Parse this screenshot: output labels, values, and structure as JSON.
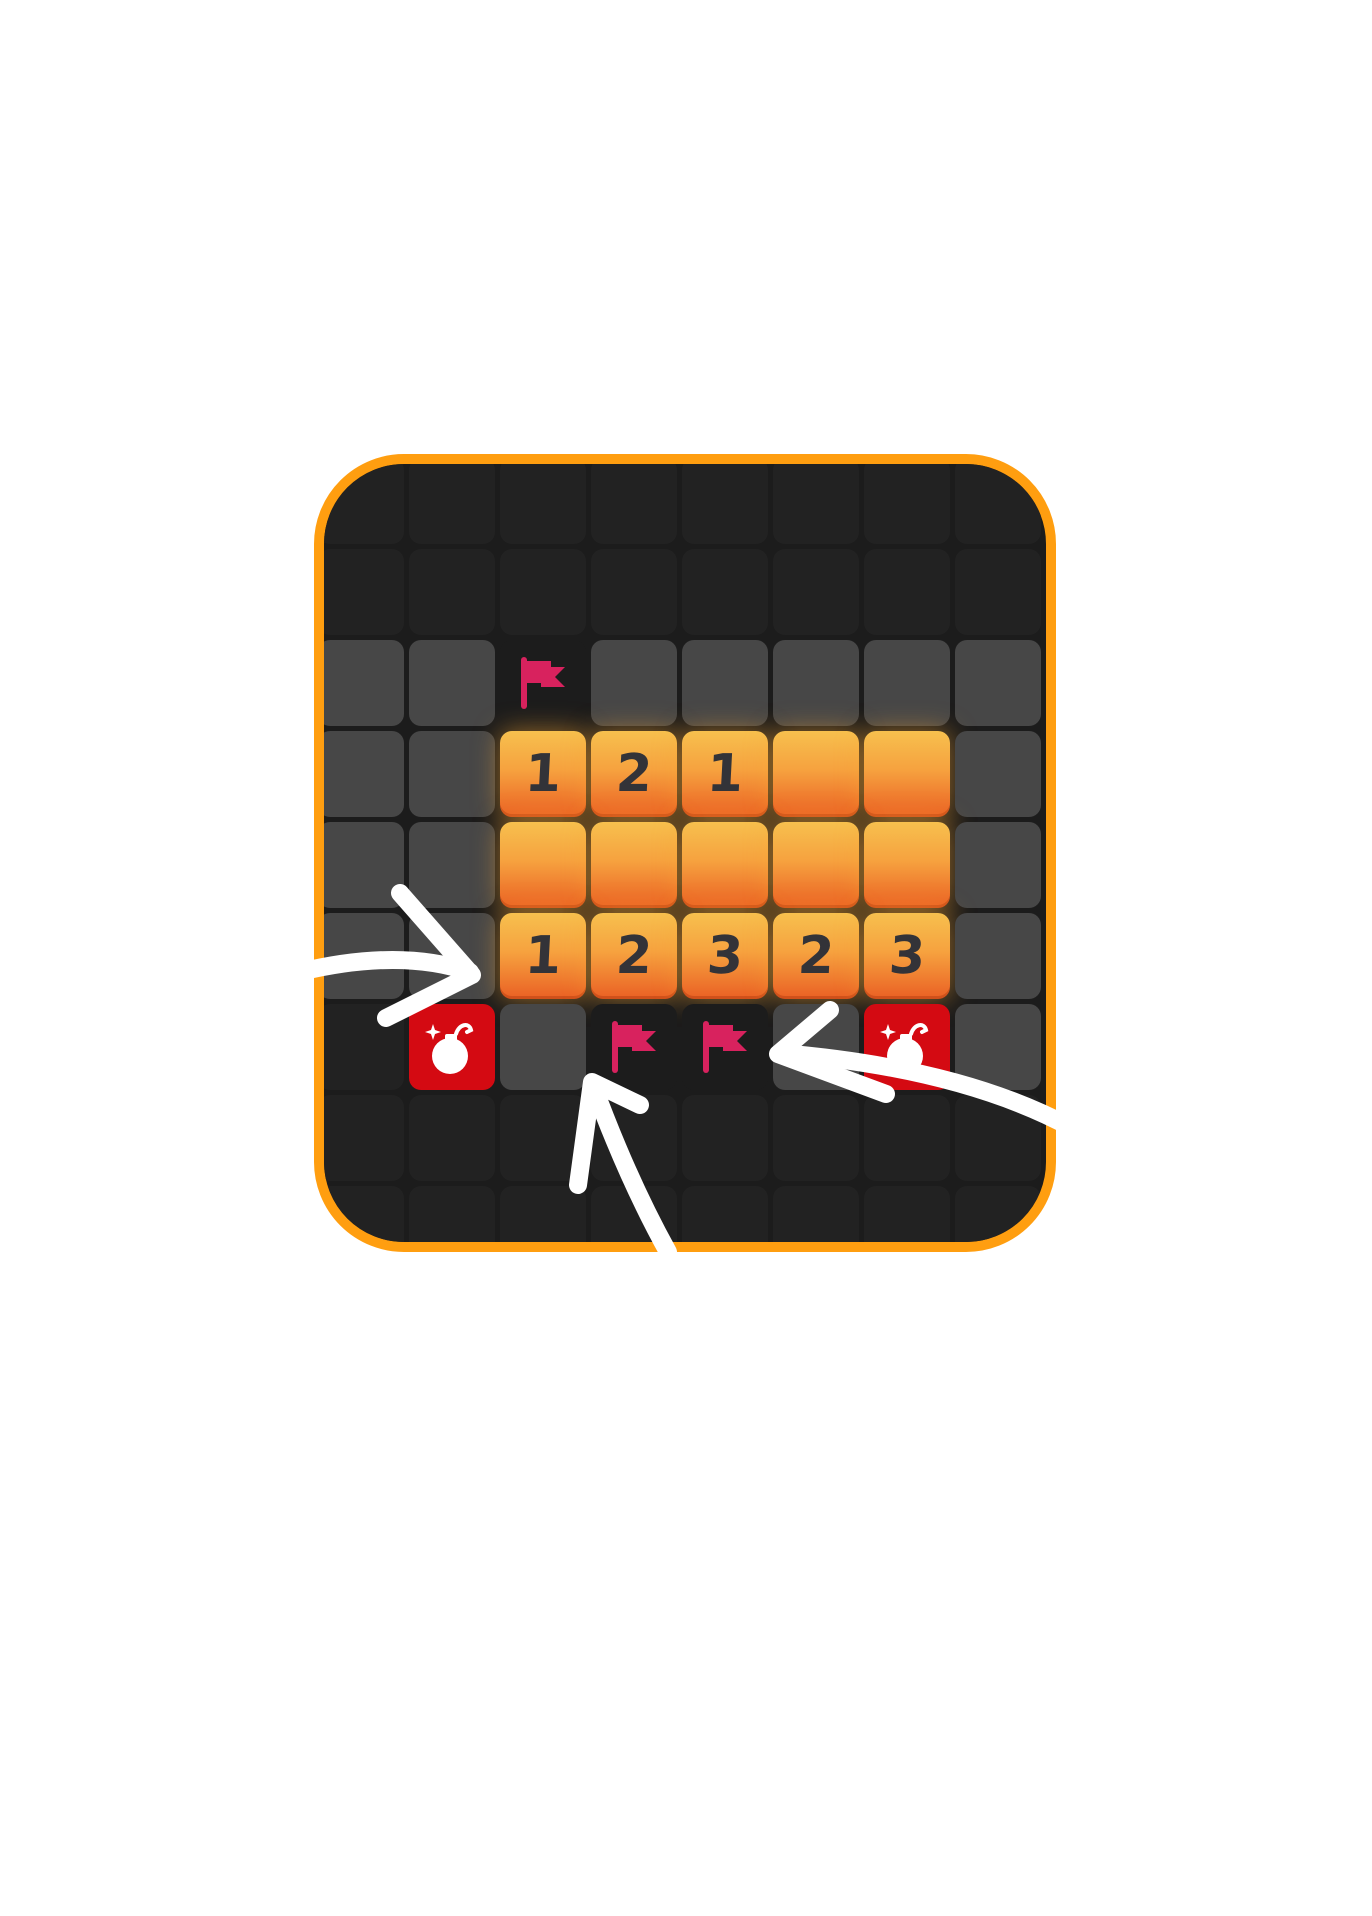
{
  "board": {
    "rows": 9,
    "cols": 8,
    "colors": {
      "frame": "#ff9e10",
      "background": "#1c1c1c",
      "hidden_dark": "#222222",
      "hidden_grey": "#474747",
      "revealed_top": "#f7c04e",
      "revealed_bottom": "#ea6024",
      "number": "#333338",
      "flag": "#d8225e",
      "mine_bg": "#d40a12"
    },
    "cells": [
      [
        "dark",
        "dark",
        "dark",
        "dark",
        "dark",
        "dark",
        "dark",
        "dark"
      ],
      [
        "dark",
        "dark",
        "dark",
        "dark",
        "dark",
        "dark",
        "dark",
        "dark"
      ],
      [
        "grey",
        "grey",
        "flag-dark",
        "grey",
        "grey",
        "grey",
        "grey",
        "grey"
      ],
      [
        "grey",
        "grey",
        "1",
        "2",
        "1",
        "open",
        "open",
        "grey"
      ],
      [
        "grey",
        "grey",
        "open",
        "open",
        "open",
        "open",
        "open",
        "grey"
      ],
      [
        "grey",
        "grey",
        "1",
        "2",
        "3",
        "2",
        "3",
        "grey"
      ],
      [
        "dark",
        "mine",
        "grey",
        "flag-dark",
        "flag-dark",
        "grey",
        "mine",
        "grey"
      ],
      [
        "dark",
        "dark",
        "dark",
        "dark",
        "dark",
        "dark",
        "dark",
        "dark"
      ],
      [
        "dark",
        "dark",
        "dark",
        "dark",
        "dark",
        "dark",
        "dark",
        "dark"
      ]
    ]
  },
  "icons": {
    "flag": "flag-icon",
    "mine": "bomb-icon",
    "arrow": "arrow-icon"
  }
}
